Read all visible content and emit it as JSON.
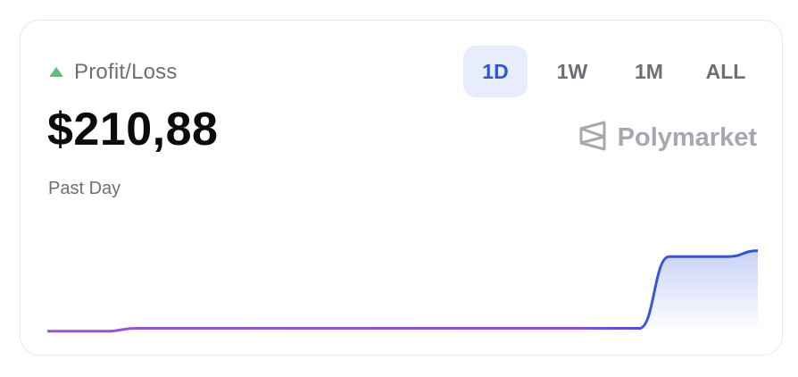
{
  "widget": {
    "label": "Profit/Loss",
    "value": "$210,88",
    "period": "Past Day",
    "brand": "Polymarket",
    "trend": "up",
    "colors": {
      "up": "#5fbf74",
      "active_tab_bg": "#e8edfb",
      "active_tab_text": "#2f55d4",
      "line_start": "#9b55d6",
      "line_end": "#2f55d4"
    }
  },
  "tabs": [
    {
      "label": "1D",
      "active": true
    },
    {
      "label": "1W",
      "active": false
    },
    {
      "label": "1M",
      "active": false
    },
    {
      "label": "ALL",
      "active": false
    }
  ],
  "chart_data": {
    "type": "area",
    "x": [
      0,
      1,
      2,
      3,
      4,
      5,
      6,
      7,
      8,
      9,
      10,
      11,
      12,
      13,
      14,
      15,
      16,
      17,
      18,
      19,
      20,
      21,
      22,
      23,
      24
    ],
    "values": [
      2,
      2,
      2,
      5,
      5,
      5,
      5,
      5,
      5,
      5,
      5,
      5,
      5,
      5,
      5,
      5,
      5,
      5,
      5,
      5,
      5,
      78,
      78,
      78,
      84
    ],
    "ylim": [
      0,
      100
    ],
    "grid": false
  }
}
